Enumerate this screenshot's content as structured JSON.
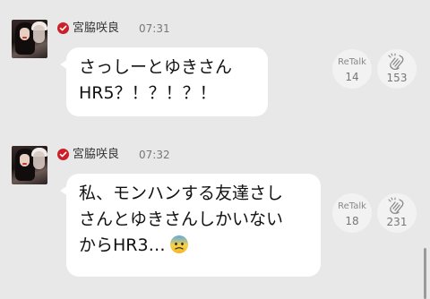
{
  "messages": [
    {
      "author": "宮脇咲良",
      "time": "07:31",
      "lines": [
        "さっしーとゆきさん",
        "HR5？！？！？！"
      ],
      "retalk_label": "ReTalk",
      "retalk_count": "14",
      "clap_count": "153"
    },
    {
      "author": "宮脇咲良",
      "time": "07:32",
      "lines": [
        "私、モンハンする友達さし",
        "さんとゆきさんしかいない",
        "からHR3…"
      ],
      "retalk_label": "ReTalk",
      "retalk_count": "18",
      "clap_count": "231"
    }
  ],
  "icons": {
    "verified": "verified-badge-icon",
    "clap": "clap-icon",
    "emoji": "anxious-face-emoji"
  },
  "colors": {
    "background": "#e8e8e8",
    "bubble": "#ffffff",
    "badge": "#cc1f2a",
    "action_circle": "#f2f2f2"
  }
}
